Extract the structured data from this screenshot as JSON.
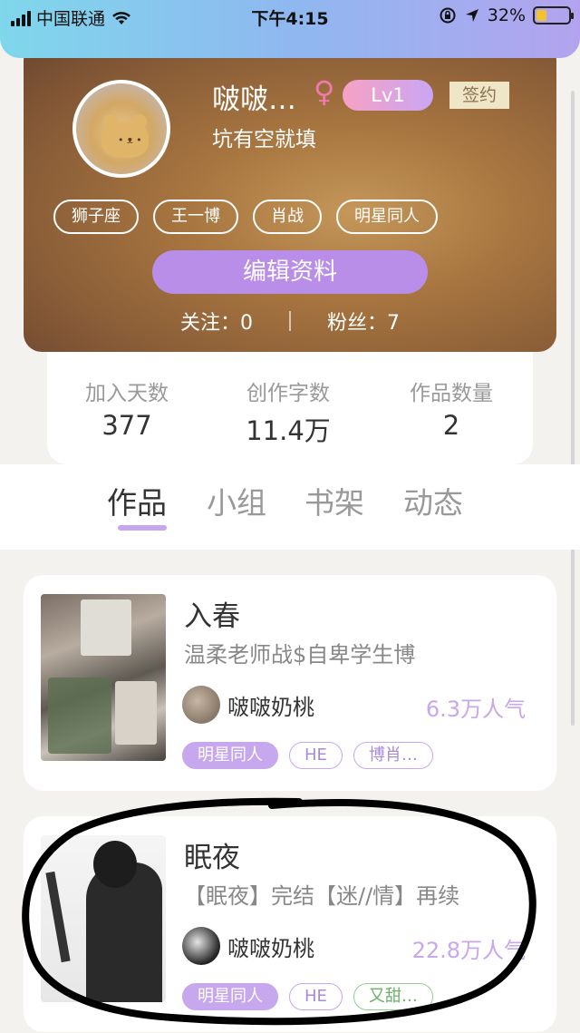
{
  "status_bar": {
    "carrier": "中国联通",
    "time": "下午4:15",
    "battery": "32%",
    "battery_level": 0.32
  },
  "profile": {
    "username": "啵啵…",
    "gender_symbol": "♀",
    "level": "Lv1",
    "sign_label": "签约",
    "bio": "坑有空就填",
    "tags": [
      "狮子座",
      "王一博",
      "肖战",
      "明星同人"
    ],
    "edit_label": "编辑资料",
    "following_label": "关注：0",
    "followers_label": "粉丝：7"
  },
  "stats": [
    {
      "label": "加入天数",
      "value": "377"
    },
    {
      "label": "创作字数",
      "value": "11.4万"
    },
    {
      "label": "作品数量",
      "value": "2"
    }
  ],
  "tabs": [
    "作品",
    "小组",
    "书架",
    "动态"
  ],
  "works": [
    {
      "title": "入春",
      "desc": "温柔老师战$自卑学生博",
      "author": "啵啵奶桃",
      "popularity": "6.3万人气",
      "tags": [
        "明星同人",
        "HE",
        "博肖…"
      ]
    },
    {
      "title": "眠夜",
      "desc": "【眠夜】完结【迷//情】再续",
      "author": "啵啵奶桃",
      "popularity": "22.8万人气",
      "tags": [
        "明星同人",
        "HE",
        "又甜…"
      ]
    }
  ],
  "colors": {
    "accent": "#c7a7ee",
    "status_gradient": [
      "#7fd7ec",
      "#b3a3ef"
    ]
  }
}
